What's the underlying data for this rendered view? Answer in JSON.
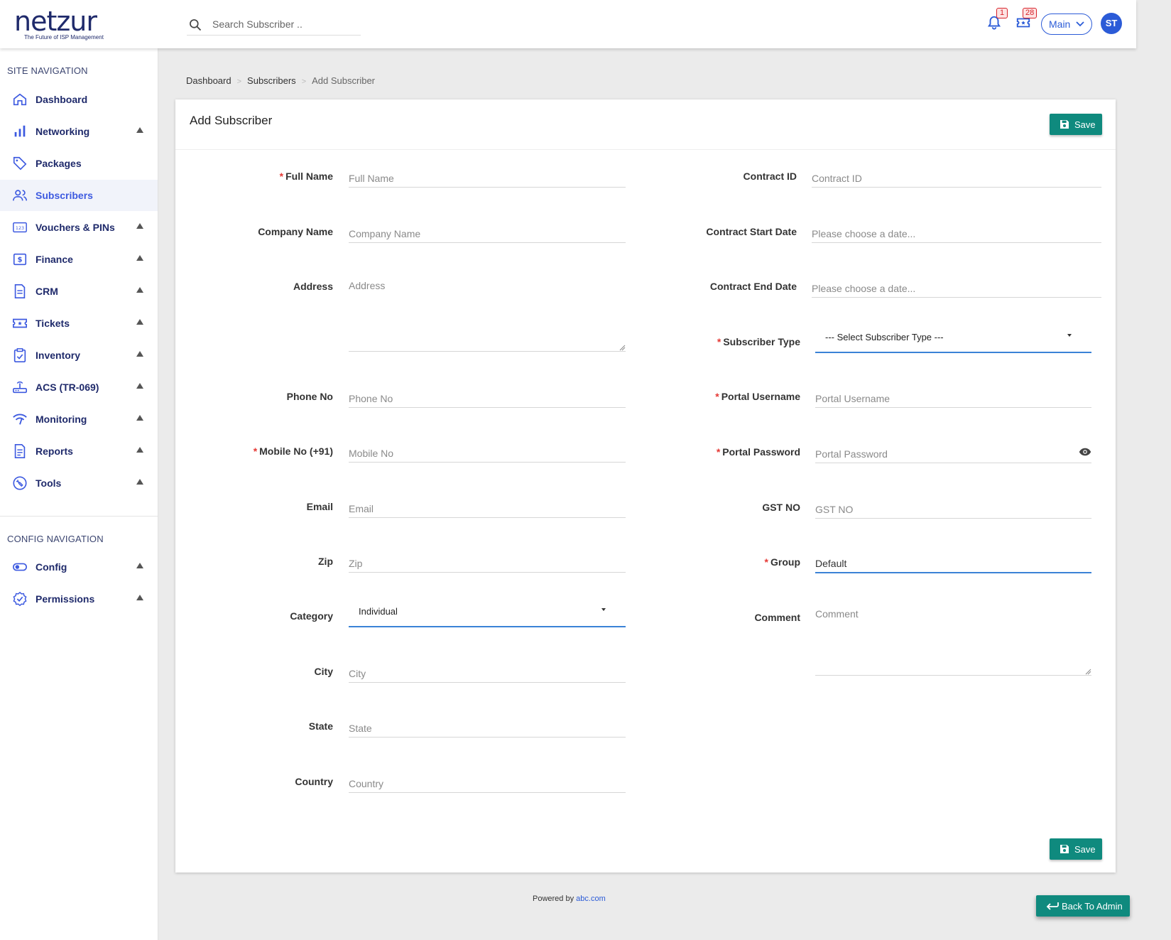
{
  "brand": {
    "name": "netzur",
    "tagline": "The Future of ISP Management"
  },
  "header": {
    "search_placeholder": "Search Subscriber ..",
    "notifications_count": "1",
    "tickets_count": "28",
    "context_select": "Main",
    "avatar_initials": "ST"
  },
  "sidebar": {
    "site_title": "SITE NAVIGATION",
    "config_title": "CONFIG NAVIGATION",
    "items": [
      {
        "label": "Dashboard",
        "icon": "home-icon"
      },
      {
        "label": "Networking",
        "icon": "bar-chart-icon"
      },
      {
        "label": "Packages",
        "icon": "tag-icon"
      },
      {
        "label": "Subscribers",
        "icon": "users-icon"
      },
      {
        "label": "Vouchers & PINs",
        "icon": "pin-123-icon"
      },
      {
        "label": "Finance",
        "icon": "dollar-icon"
      },
      {
        "label": "CRM",
        "icon": "document-icon"
      },
      {
        "label": "Tickets",
        "icon": "ticket-icon"
      },
      {
        "label": "Inventory",
        "icon": "clipboard-check-icon"
      },
      {
        "label": "ACS (TR-069)",
        "icon": "router-icon"
      },
      {
        "label": "Monitoring",
        "icon": "signal-icon"
      },
      {
        "label": "Reports",
        "icon": "report-icon"
      },
      {
        "label": "Tools",
        "icon": "wrench-icon"
      }
    ],
    "config_items": [
      {
        "label": "Config",
        "icon": "toggle-icon"
      },
      {
        "label": "Permissions",
        "icon": "badge-check-icon"
      }
    ]
  },
  "breadcrumb": {
    "items": [
      "Dashboard",
      "Subscribers",
      "Add Subscriber"
    ],
    "separator": ">"
  },
  "form": {
    "title": "Add Subscriber",
    "save_label": "Save",
    "left": {
      "full_name": {
        "label": "Full Name",
        "placeholder": "Full Name"
      },
      "company_name": {
        "label": "Company Name",
        "placeholder": "Company Name"
      },
      "address": {
        "label": "Address",
        "placeholder": "Address"
      },
      "phone_no": {
        "label": "Phone No",
        "placeholder": "Phone No"
      },
      "mobile_no": {
        "label": "Mobile No (+91)",
        "placeholder": "Mobile No"
      },
      "email": {
        "label": "Email",
        "placeholder": "Email"
      },
      "zip": {
        "label": "Zip",
        "placeholder": "Zip"
      },
      "category": {
        "label": "Category",
        "value": "Individual"
      },
      "city": {
        "label": "City",
        "placeholder": "City"
      },
      "state": {
        "label": "State",
        "placeholder": "State"
      },
      "country": {
        "label": "Country",
        "placeholder": "Country"
      }
    },
    "right": {
      "contract_id": {
        "label": "Contract ID",
        "placeholder": "Contract ID"
      },
      "contract_start": {
        "label": "Contract Start Date",
        "placeholder": "Please choose a date..."
      },
      "contract_end": {
        "label": "Contract End Date",
        "placeholder": "Please choose a date..."
      },
      "subscriber_type": {
        "label": "Subscriber Type",
        "value": "--- Select Subscriber Type ---"
      },
      "portal_username": {
        "label": "Portal Username",
        "placeholder": "Portal Username"
      },
      "portal_password": {
        "label": "Portal Password",
        "placeholder": "Portal Password"
      },
      "gst_no": {
        "label": "GST NO",
        "placeholder": "GST NO"
      },
      "group": {
        "label": "Group",
        "value": "Default"
      },
      "comment": {
        "label": "Comment",
        "placeholder": "Comment"
      }
    },
    "required_marker": "*"
  },
  "footer": {
    "powered_by": "Powered by",
    "link": "abc.com"
  },
  "back_label": "Back To Admin",
  "colors": {
    "brand": "#1f2a6b",
    "accent": "#3d5ae0",
    "primary_button": "#0f8a7e",
    "required": "#e53935"
  }
}
